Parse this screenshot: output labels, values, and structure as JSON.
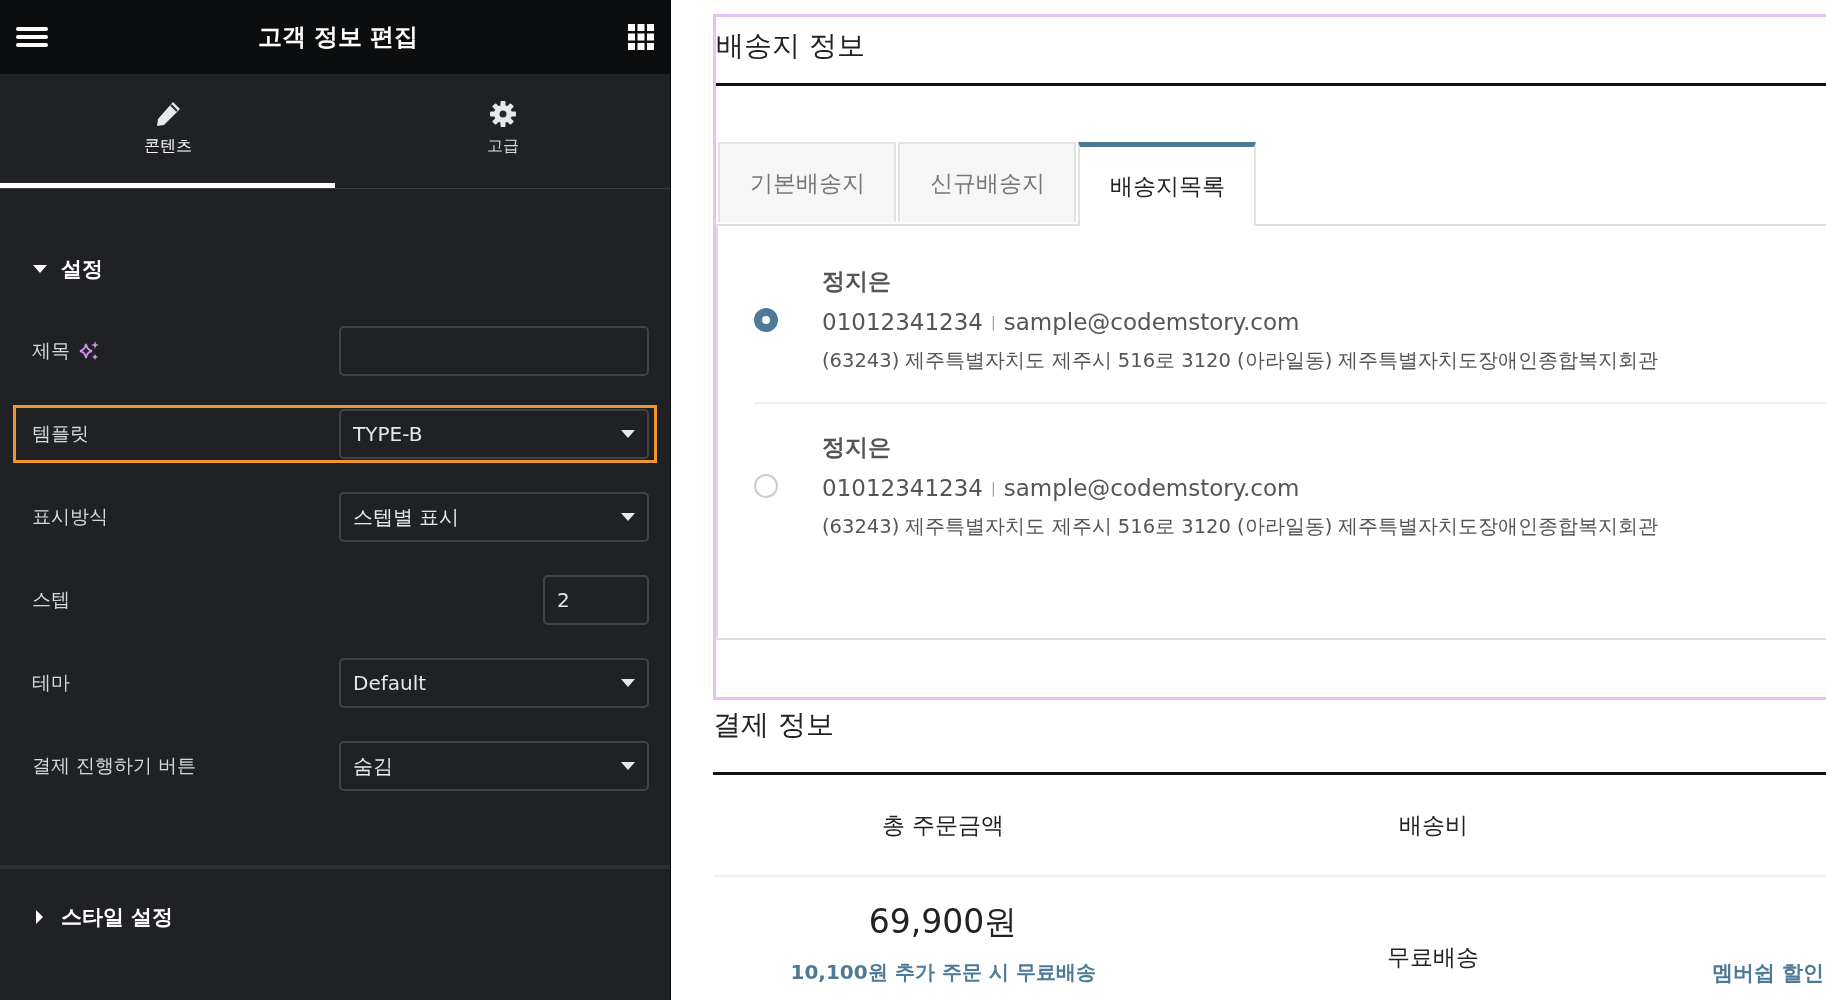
{
  "panel": {
    "title": "고객 정보 편집",
    "tabs": [
      {
        "label": "콘텐츠",
        "kind": "edit",
        "selected": true
      },
      {
        "label": "고급",
        "kind": "settings",
        "selected": false
      }
    ],
    "section": {
      "title": "설정",
      "expanded": true
    },
    "fields": [
      {
        "kind": "text",
        "label": "제목",
        "ai": true,
        "highlighted": false
      },
      {
        "kind": "select",
        "label": "템플릿",
        "value": "TYPE-B",
        "highlighted": true
      },
      {
        "kind": "select",
        "label": "표시방식",
        "value": "스텝별 표시",
        "highlighted": false
      },
      {
        "kind": "number",
        "label": "스텝",
        "value": "2",
        "highlighted": false
      },
      {
        "kind": "select",
        "label": "테마",
        "value": "Default",
        "highlighted": false
      },
      {
        "kind": "select",
        "label": "결제 진행하기 버튼",
        "value": "숨김",
        "highlighted": false
      }
    ],
    "collapsed_section": {
      "title": "스타일 설정",
      "expanded": false
    }
  },
  "shipping": {
    "title": "배송지 정보",
    "tabs": [
      {
        "label": "기본배송지",
        "selected": false
      },
      {
        "label": "신규배송지",
        "selected": false
      },
      {
        "label": "배송지목록",
        "selected": true
      }
    ],
    "addresses": [
      {
        "name": "정지은",
        "phone": "01012341234",
        "separator": "|",
        "email": "sample@codemstory.com",
        "address": "(63243) 제주특별자치도 제주시 516로 3120 (아라일동) 제주특별자치도장애인종합복지회관",
        "selected": true
      },
      {
        "name": "정지은",
        "phone": "01012341234",
        "separator": "|",
        "email": "sample@codemstory.com",
        "address": "(63243) 제주특별자치도 제주시 516로 3120 (아라일동) 제주특별자치도장애인종합복지회관",
        "selected": false
      }
    ]
  },
  "payment": {
    "title": "결제 정보",
    "columns": [
      "총 주문금액",
      "배송비"
    ],
    "total": "69,900원",
    "free_shipping_note": "10,100원 추가 주문 시 무료배송",
    "shipping_fee": "무료배송",
    "membership_link": "멤버쉽 할인"
  }
}
